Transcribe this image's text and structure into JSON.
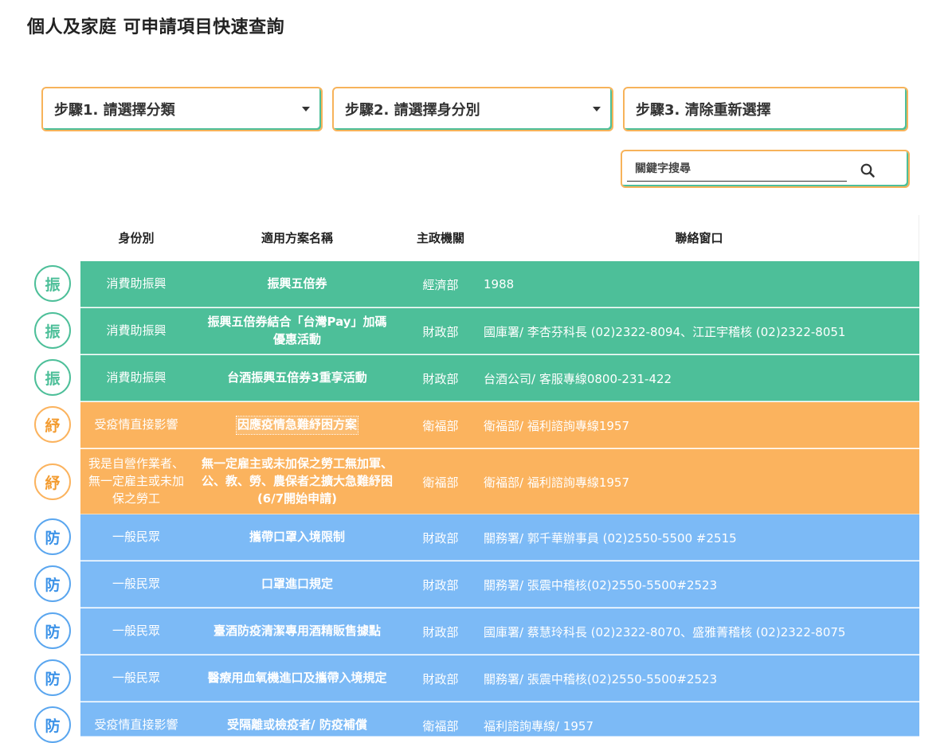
{
  "title": "個人及家庭 可申請項目快速查詢",
  "filters": {
    "step1": "步驟1. 請選擇分類",
    "step2": "步驟2. 請選擇身分別",
    "step3": "步驟3. 清除重新選擇"
  },
  "search": {
    "placeholder": "關鍵字搜尋",
    "icon": "search-icon"
  },
  "colors": {
    "green": "#4dbf99",
    "orange": "#fbb35e",
    "blue": "#7cbaf6"
  },
  "table": {
    "headers": {
      "status": "身份別",
      "plan": "適用方案名稱",
      "agency": "主政機關",
      "contact": "聯絡窗口"
    },
    "rows": [
      {
        "badge": "振",
        "color": "green",
        "status": "消費助振興",
        "plan": "振興五倍券",
        "agency": "經濟部",
        "contact": "1988"
      },
      {
        "badge": "振",
        "color": "green",
        "status": "消費助振興",
        "plan": "振興五倍券結合「台灣Pay」加碼優惠活動",
        "agency": "財政部",
        "contact": "國庫署/ 李杏芬科長 (02)2322-8094、江正宇稽核 (02)2322-8051"
      },
      {
        "badge": "振",
        "color": "green",
        "status": "消費助振興",
        "plan": "台酒振興五倍券3重享活動",
        "agency": "財政部",
        "contact": "台酒公司/ 客服專線0800-231-422"
      },
      {
        "badge": "紓",
        "color": "orange",
        "status": "受疫情直接影響",
        "plan": "因應疫情急難紓困方案",
        "agency": "衛福部",
        "contact": "衛福部/ 福利諮詢專線1957"
      },
      {
        "badge": "紓",
        "color": "orange",
        "status": "我是自營作業者、無一定雇主或未加保之勞工",
        "plan": "無一定雇主或未加保之勞工無加軍、公、教、勞、農保者之擴大急難紓困(6/7開始申請)",
        "agency": "衛福部",
        "contact": "衛福部/ 福利諮詢專線1957"
      },
      {
        "badge": "防",
        "color": "blue",
        "status": "一般民眾",
        "plan": "攜帶口罩入境限制",
        "agency": "財政部",
        "contact": "關務署/ 郭千華辦事員 (02)2550-5500 #2515"
      },
      {
        "badge": "防",
        "color": "blue",
        "status": "一般民眾",
        "plan": "口罩進口規定",
        "agency": "財政部",
        "contact": "關務署/ 張震中稽核(02)2550-5500#2523"
      },
      {
        "badge": "防",
        "color": "blue",
        "status": "一般民眾",
        "plan": "臺酒防疫清潔專用酒精販售據點",
        "agency": "財政部",
        "contact": "國庫署/ 蔡慧玲科長 (02)2322-8070、盛雅菁稽核 (02)2322-8075"
      },
      {
        "badge": "防",
        "color": "blue",
        "status": "一般民眾",
        "plan": "醫療用血氧機進口及攜帶入境規定",
        "agency": "財政部",
        "contact": "關務署/ 張震中稽核(02)2550-5500#2523"
      },
      {
        "badge": "防",
        "color": "blue",
        "status": "受疫情直接影響",
        "plan": "受隔離或檢疫者/ 防疫補償",
        "agency": "衛福部",
        "contact": "福利諮詢專線/ 1957"
      }
    ]
  }
}
